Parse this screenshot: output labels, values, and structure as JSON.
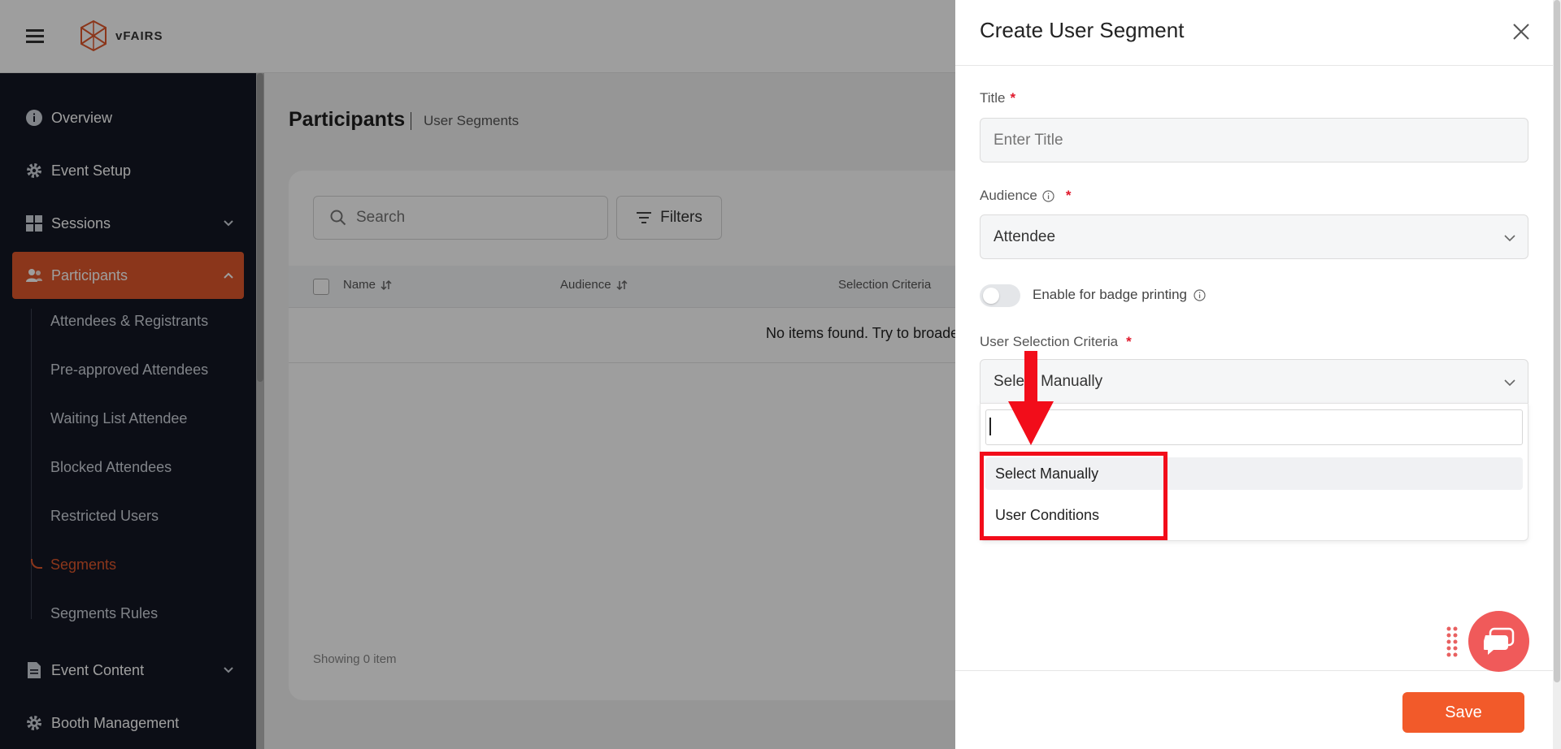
{
  "brand": {
    "logo_text": "vFAIRS"
  },
  "sidebar": {
    "items": [
      {
        "label": "Overview",
        "icon": "info-icon"
      },
      {
        "label": "Event Setup",
        "icon": "gear-icon"
      },
      {
        "label": "Sessions",
        "icon": "grid-icon"
      },
      {
        "label": "Participants",
        "icon": "users-icon"
      },
      {
        "label": "Event Content",
        "icon": "document-icon"
      },
      {
        "label": "Booth Management",
        "icon": "gear-icon"
      }
    ],
    "sub_items": [
      {
        "label": "Attendees & Registrants"
      },
      {
        "label": "Pre-approved Attendees"
      },
      {
        "label": "Waiting List Attendee"
      },
      {
        "label": "Blocked Attendees"
      },
      {
        "label": "Restricted Users"
      },
      {
        "label": "Segments"
      },
      {
        "label": "Segments Rules"
      }
    ]
  },
  "page": {
    "title": "Participants",
    "crumb": "User Segments",
    "search_placeholder": "Search",
    "filters_label": "Filters",
    "columns": [
      "Name",
      "Audience",
      "Selection Criteria"
    ],
    "empty_text": "No items found. Try to broade",
    "showing_text": "Showing 0 item"
  },
  "drawer": {
    "title": "Create User Segment",
    "title_label": "Title",
    "title_placeholder": "Enter Title",
    "audience_label": "Audience",
    "audience_value": "Attendee",
    "badge_label": "Enable for badge printing",
    "criteria_label": "User Selection Criteria",
    "criteria_value": "Select Manually",
    "options": [
      "Select Manually",
      "User Conditions"
    ],
    "save_label": "Save",
    "required_mark": "*"
  },
  "colors": {
    "accent": "#e0582c",
    "annotation": "#f20d1a",
    "save": "#f25a2a"
  }
}
